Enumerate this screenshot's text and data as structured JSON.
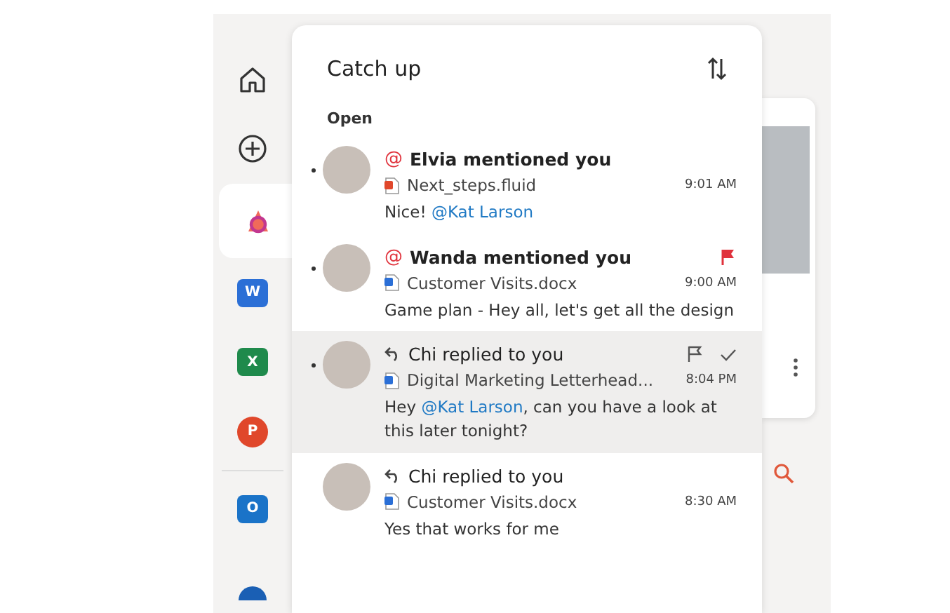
{
  "rail": [
    {
      "kind": "home",
      "selected": false
    },
    {
      "kind": "new",
      "selected": false
    },
    {
      "kind": "loop",
      "selected": true
    },
    {
      "kind": "word",
      "letter": "W",
      "selected": false
    },
    {
      "kind": "excel",
      "letter": "X",
      "selected": false
    },
    {
      "kind": "powerpoint",
      "letter": "P",
      "selected": false
    },
    {
      "kind": "divider"
    },
    {
      "kind": "outlook",
      "letter": "O",
      "selected": false
    },
    {
      "kind": "more",
      "selected": false
    }
  ],
  "panel": {
    "title": "Catch up",
    "section": "Open",
    "items": [
      {
        "kind": "mention",
        "prefix": "@",
        "title": "Elvia mentioned you",
        "file": {
          "name": "Next_steps.fluid",
          "kind": "fluid"
        },
        "time": "9:01 AM",
        "unread": true,
        "selected": false,
        "flagged": false,
        "message": [
          {
            "text": "Nice! "
          },
          {
            "text": "@Kat Larson",
            "kind": "mention"
          }
        ]
      },
      {
        "kind": "mention",
        "prefix": "@",
        "title": "Wanda mentioned you",
        "file": {
          "name": "Customer Visits.docx",
          "kind": "docx"
        },
        "time": "9:00 AM",
        "unread": true,
        "selected": false,
        "flagged": true,
        "message": [
          {
            "text": "Game plan - Hey all, let's get all the design"
          }
        ]
      },
      {
        "kind": "reply",
        "title": "Chi replied to you",
        "file": {
          "name": "Digital Marketing Letterhead...",
          "kind": "docx"
        },
        "time": "8:04 PM",
        "unread": true,
        "selected": true,
        "flagged": false,
        "message": [
          {
            "text": "Hey "
          },
          {
            "text": "@Kat Larson",
            "kind": "mention"
          },
          {
            "text": ", can you have a look at this later tonight?"
          }
        ]
      },
      {
        "kind": "reply",
        "title": "Chi replied to you",
        "file": {
          "name": "Customer Visits.docx",
          "kind": "docx"
        },
        "time": "8:30 AM",
        "unread": false,
        "selected": false,
        "flagged": false,
        "message": [
          {
            "text": "Yes that works for me"
          }
        ]
      }
    ]
  }
}
